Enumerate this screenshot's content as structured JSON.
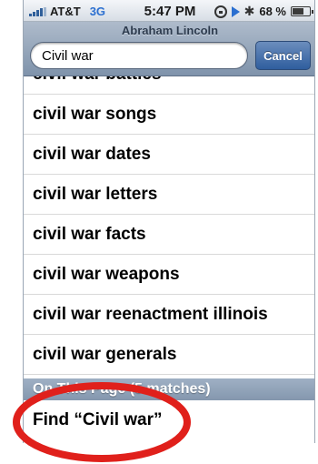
{
  "status_bar": {
    "carrier": "AT&T",
    "network": "3G",
    "time": "5:47 PM",
    "battery": "68 %",
    "battery_level": 0.68,
    "icons": [
      "signal-icon",
      "orientation-lock-icon",
      "play-icon",
      "bluetooth-icon",
      "battery-icon"
    ]
  },
  "header": {
    "title": "Abraham Lincoln",
    "search_value": "Civil war",
    "cancel_label": "Cancel"
  },
  "suggestions": [
    "civil war battles",
    "civil war songs",
    "civil war dates",
    "civil war letters",
    "civil war facts",
    "civil war weapons",
    "civil war reenactment illinois",
    "civil war generals"
  ],
  "section_header": "On This Page (5 matches)",
  "find_label": "Find “Civil war”",
  "colors": {
    "accent": "#2f5e9e",
    "annotation": "#e0201b"
  }
}
